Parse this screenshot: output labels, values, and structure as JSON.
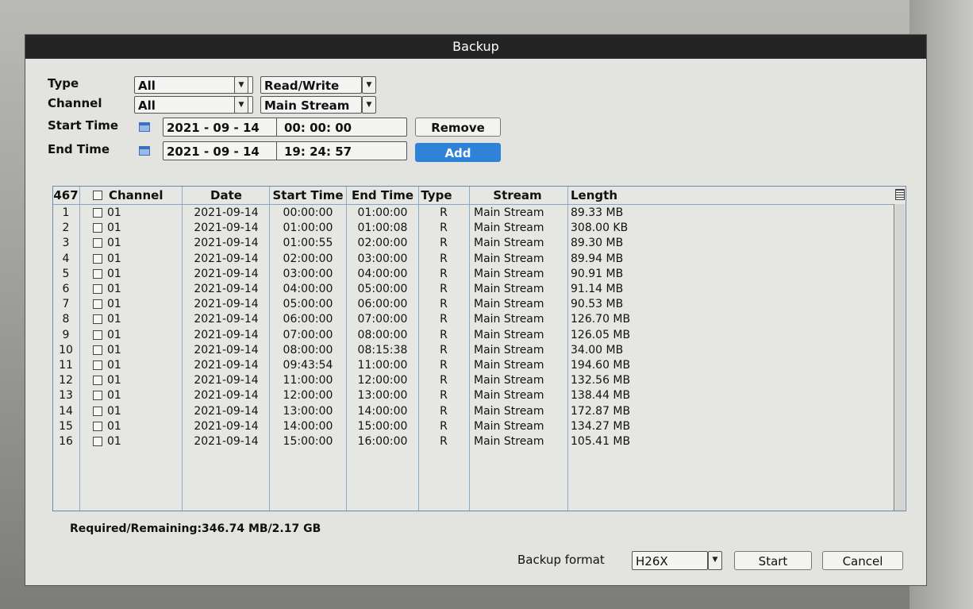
{
  "title": "Backup",
  "filters": {
    "type_label": "Type",
    "type_value": "All",
    "rw_value": "Read/Write",
    "channel_label": "Channel",
    "channel_value": "All",
    "stream_value": "Main Stream",
    "start_label": "Start Time",
    "start_date": "2021 - 09 - 14",
    "start_time": "00: 00: 00",
    "end_label": "End Time",
    "end_date": "2021 - 09 - 14",
    "end_time": "19: 24: 57",
    "remove_label": "Remove",
    "add_label": "Add"
  },
  "table": {
    "count": "467",
    "headers": {
      "channel": "Channel",
      "date": "Date",
      "start": "Start Time",
      "end": "End Time",
      "type": "Type",
      "stream": "Stream",
      "length": "Length"
    },
    "rows": [
      {
        "n": "1",
        "ch": "01",
        "date": "2021-09-14",
        "start": "00:00:00",
        "end": "01:00:00",
        "type": "R",
        "stream": "Main Stream",
        "len": "89.33 MB"
      },
      {
        "n": "2",
        "ch": "01",
        "date": "2021-09-14",
        "start": "01:00:00",
        "end": "01:00:08",
        "type": "R",
        "stream": "Main Stream",
        "len": "308.00 KB"
      },
      {
        "n": "3",
        "ch": "01",
        "date": "2021-09-14",
        "start": "01:00:55",
        "end": "02:00:00",
        "type": "R",
        "stream": "Main Stream",
        "len": "89.30 MB"
      },
      {
        "n": "4",
        "ch": "01",
        "date": "2021-09-14",
        "start": "02:00:00",
        "end": "03:00:00",
        "type": "R",
        "stream": "Main Stream",
        "len": "89.94 MB"
      },
      {
        "n": "5",
        "ch": "01",
        "date": "2021-09-14",
        "start": "03:00:00",
        "end": "04:00:00",
        "type": "R",
        "stream": "Main Stream",
        "len": "90.91 MB"
      },
      {
        "n": "6",
        "ch": "01",
        "date": "2021-09-14",
        "start": "04:00:00",
        "end": "05:00:00",
        "type": "R",
        "stream": "Main Stream",
        "len": "91.14 MB"
      },
      {
        "n": "7",
        "ch": "01",
        "date": "2021-09-14",
        "start": "05:00:00",
        "end": "06:00:00",
        "type": "R",
        "stream": "Main Stream",
        "len": "90.53 MB"
      },
      {
        "n": "8",
        "ch": "01",
        "date": "2021-09-14",
        "start": "06:00:00",
        "end": "07:00:00",
        "type": "R",
        "stream": "Main Stream",
        "len": "126.70 MB"
      },
      {
        "n": "9",
        "ch": "01",
        "date": "2021-09-14",
        "start": "07:00:00",
        "end": "08:00:00",
        "type": "R",
        "stream": "Main Stream",
        "len": "126.05 MB"
      },
      {
        "n": "10",
        "ch": "01",
        "date": "2021-09-14",
        "start": "08:00:00",
        "end": "08:15:38",
        "type": "R",
        "stream": "Main Stream",
        "len": "34.00 MB"
      },
      {
        "n": "11",
        "ch": "01",
        "date": "2021-09-14",
        "start": "09:43:54",
        "end": "11:00:00",
        "type": "R",
        "stream": "Main Stream",
        "len": "194.60 MB"
      },
      {
        "n": "12",
        "ch": "01",
        "date": "2021-09-14",
        "start": "11:00:00",
        "end": "12:00:00",
        "type": "R",
        "stream": "Main Stream",
        "len": "132.56 MB"
      },
      {
        "n": "13",
        "ch": "01",
        "date": "2021-09-14",
        "start": "12:00:00",
        "end": "13:00:00",
        "type": "R",
        "stream": "Main Stream",
        "len": "138.44 MB"
      },
      {
        "n": "14",
        "ch": "01",
        "date": "2021-09-14",
        "start": "13:00:00",
        "end": "14:00:00",
        "type": "R",
        "stream": "Main Stream",
        "len": "172.87 MB"
      },
      {
        "n": "15",
        "ch": "01",
        "date": "2021-09-14",
        "start": "14:00:00",
        "end": "15:00:00",
        "type": "R",
        "stream": "Main Stream",
        "len": "134.27 MB"
      },
      {
        "n": "16",
        "ch": "01",
        "date": "2021-09-14",
        "start": "15:00:00",
        "end": "16:00:00",
        "type": "R",
        "stream": "Main Stream",
        "len": "105.41 MB"
      }
    ]
  },
  "footer": {
    "required": "Required/Remaining:346.74 MB/2.17 GB",
    "format_label": "Backup format",
    "format_value": "H26X",
    "start_label": "Start",
    "cancel_label": "Cancel"
  }
}
